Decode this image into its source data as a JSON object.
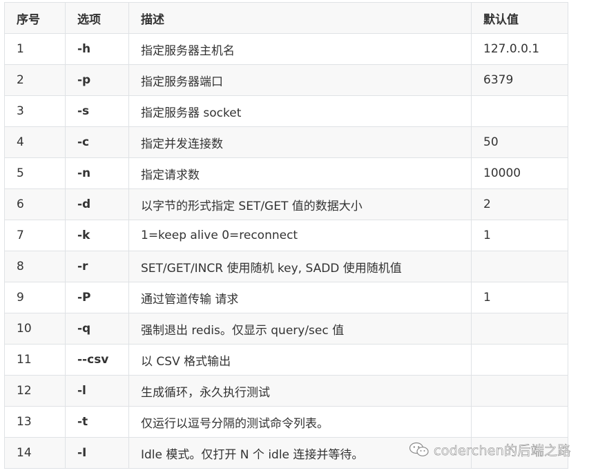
{
  "table": {
    "headers": [
      "序号",
      "选项",
      "描述",
      "默认值"
    ],
    "rows": [
      [
        "1",
        "-h",
        "指定服务器主机名",
        "127.0.0.1"
      ],
      [
        "2",
        "-p",
        "指定服务器端口",
        "6379"
      ],
      [
        "3",
        "-s",
        "指定服务器 socket",
        ""
      ],
      [
        "4",
        "-c",
        "指定并发连接数",
        "50"
      ],
      [
        "5",
        "-n",
        "指定请求数",
        "10000"
      ],
      [
        "6",
        "-d",
        "以字节的形式指定 SET/GET 值的数据大小",
        "2"
      ],
      [
        "7",
        "-k",
        "1=keep alive 0=reconnect",
        "1"
      ],
      [
        "8",
        "-r",
        "SET/GET/INCR 使用随机 key, SADD 使用随机值",
        ""
      ],
      [
        "9",
        "-P",
        "通过管道传输 请求",
        "1"
      ],
      [
        "10",
        "-q",
        "强制退出 redis。仅显示 query/sec 值",
        ""
      ],
      [
        "11",
        "--csv",
        "以 CSV 格式输出",
        ""
      ],
      [
        "12",
        "-l",
        "生成循环，永久执行测试",
        ""
      ],
      [
        "13",
        "-t",
        "仅运行以逗号分隔的测试命令列表。",
        ""
      ],
      [
        "14",
        "-I",
        "Idle 模式。仅打开 N 个 idle 连接并等待。",
        ""
      ]
    ]
  },
  "watermark": {
    "text": "coderchen的后端之路",
    "icon": "wechat-icon"
  }
}
